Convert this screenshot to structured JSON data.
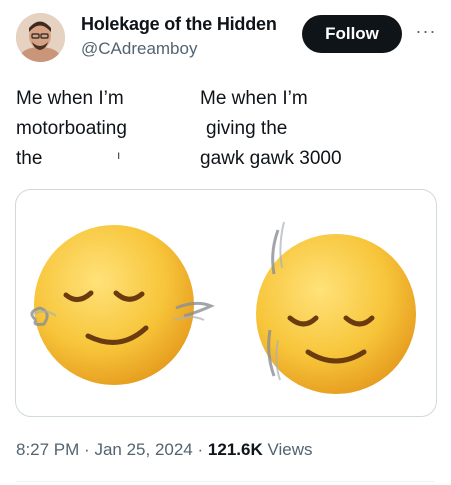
{
  "author": {
    "display_name": "Holekage of the Hidden",
    "handle": "@CAdreamboy"
  },
  "follow_button_label": "Follow",
  "more_icon_label": "···",
  "tweet": {
    "caption_left": [
      "Me when I’m",
      "motorboating",
      "the"
    ],
    "caption_right": [
      "Me when I’m",
      "giving the",
      "gawk gawk 3000"
    ],
    "stray_mark": "ı"
  },
  "meta": {
    "time": "8:27 PM",
    "date": "Jan 25, 2024",
    "views_count": "121.6K",
    "views_label": "Views",
    "separator": "·"
  },
  "colors": {
    "button_bg": "#0f1419",
    "muted_text": "#536471",
    "border": "#cfd9de",
    "emoji_yellow": "#f7c53a"
  }
}
